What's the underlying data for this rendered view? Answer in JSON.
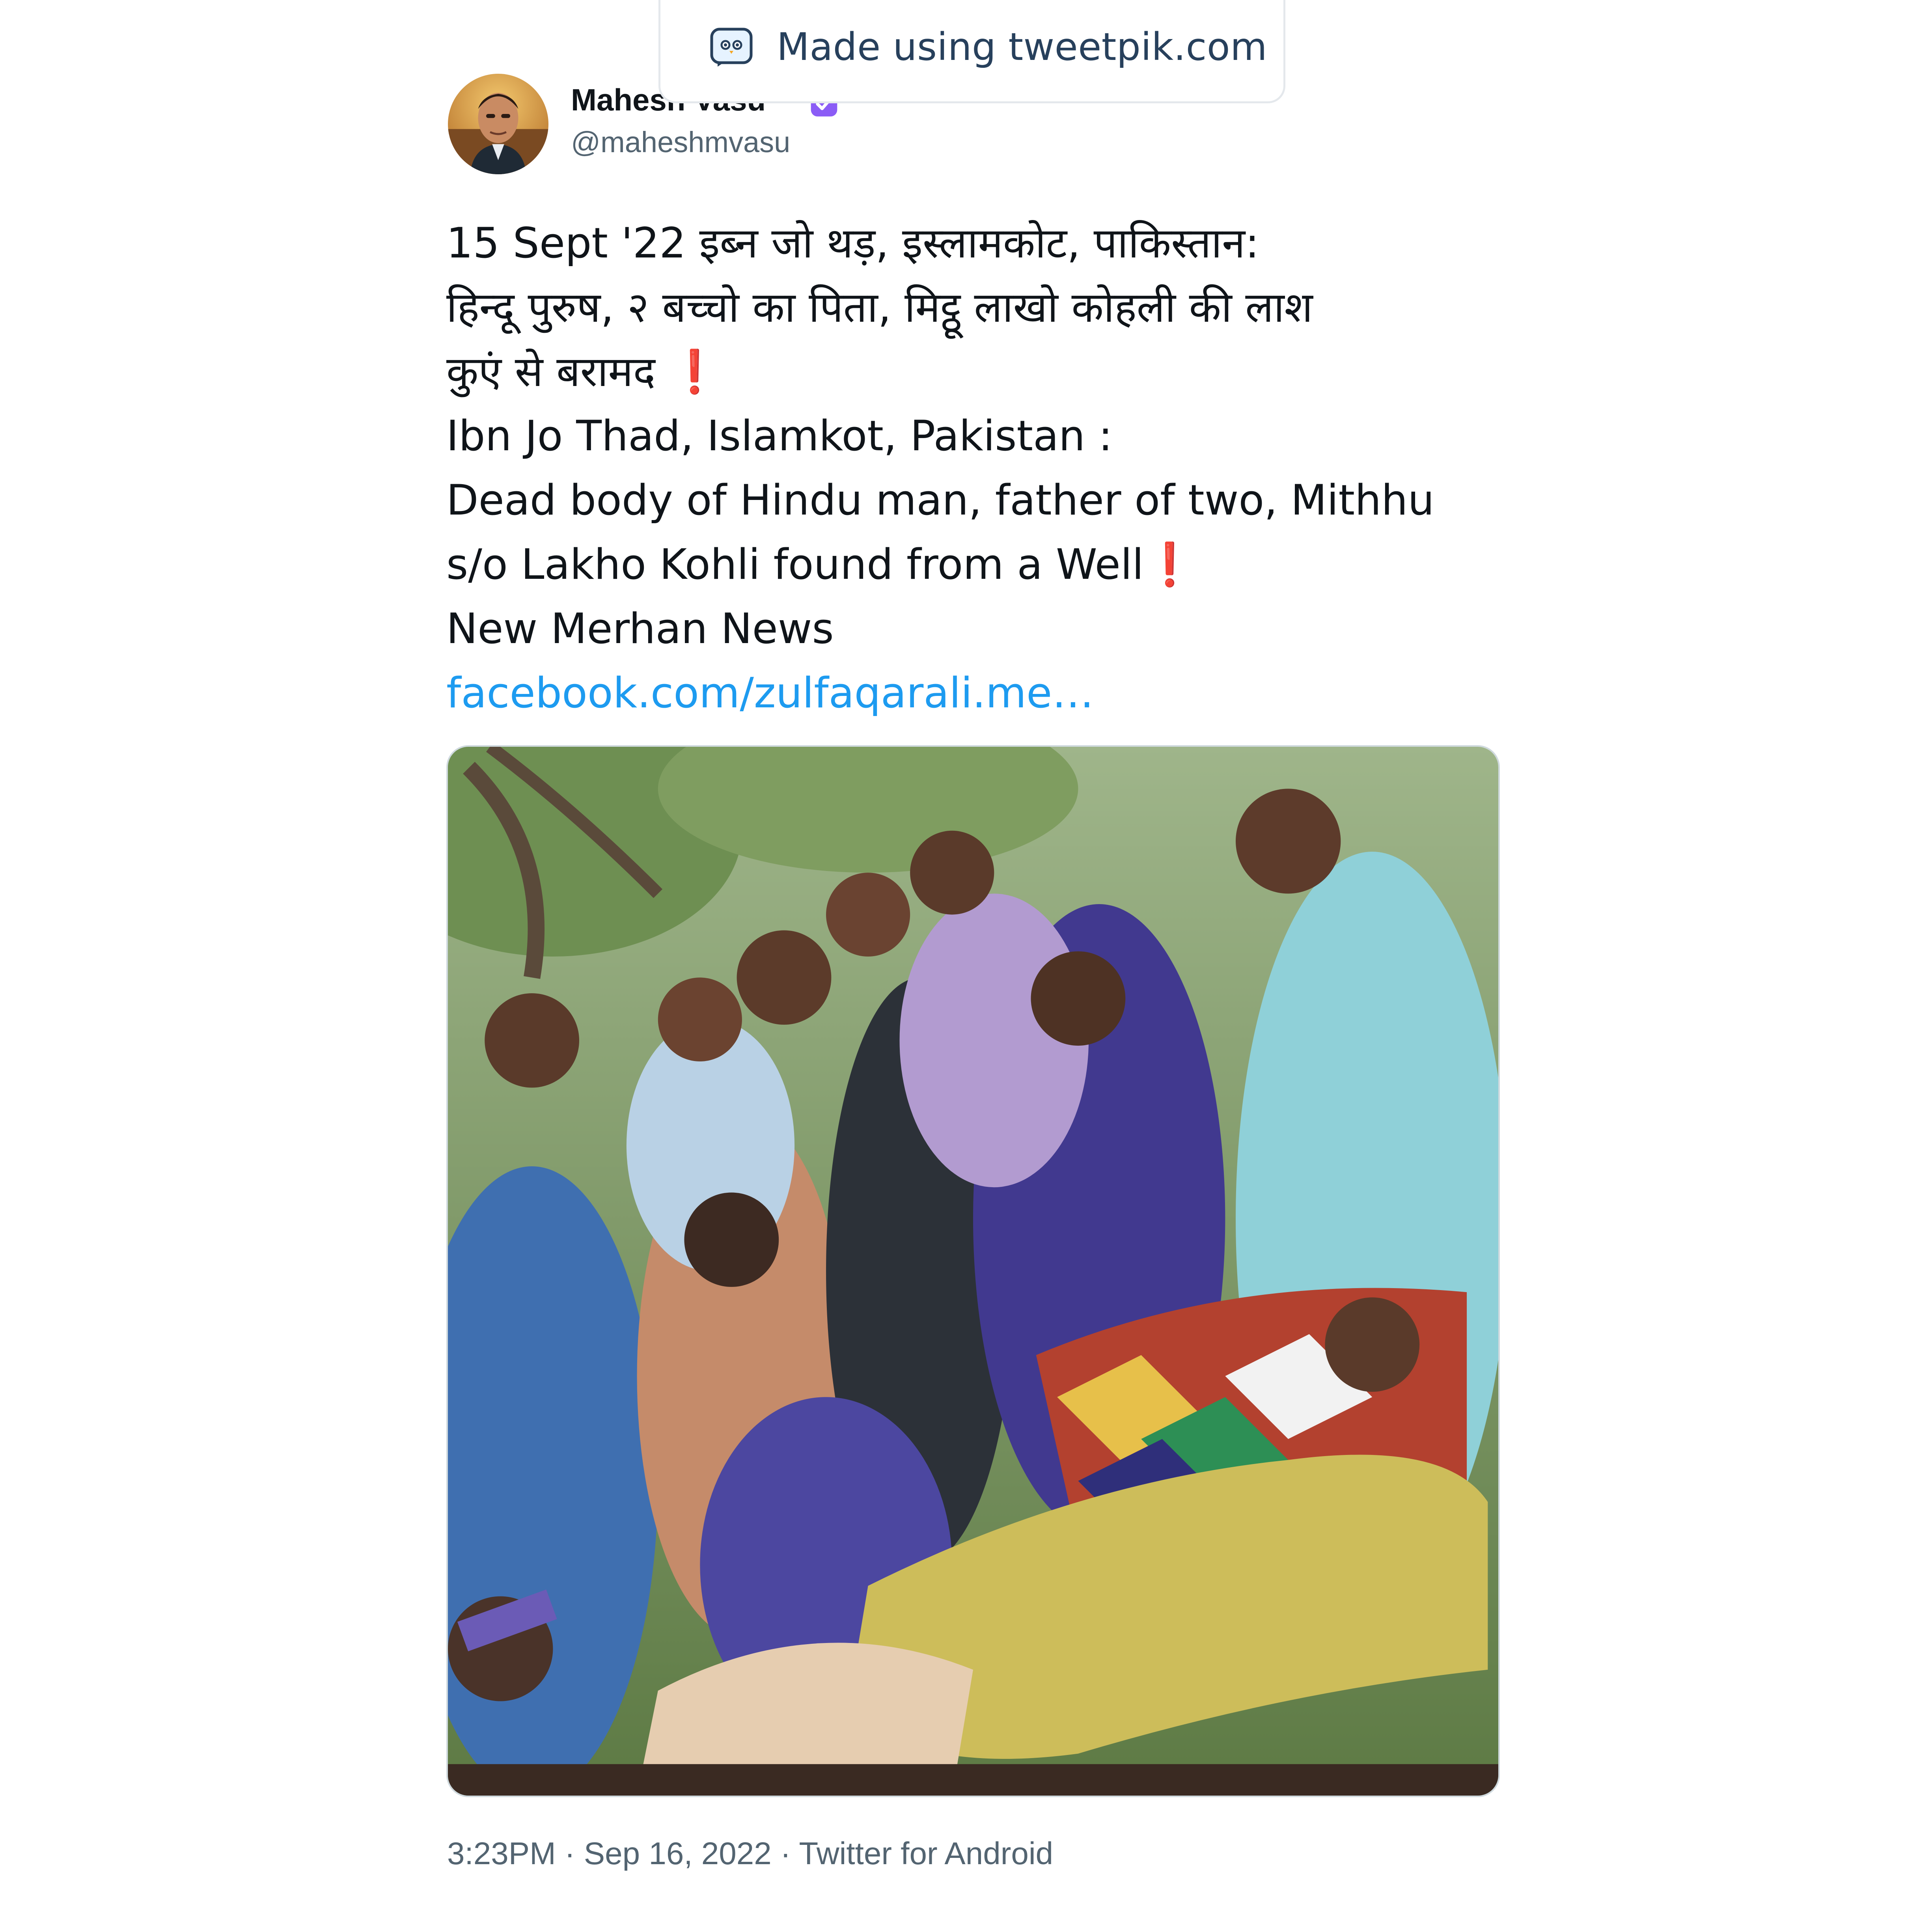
{
  "watermark": {
    "text": "Made using tweetpik.com",
    "icon": "tweetpik-logo-icon"
  },
  "author": {
    "display_name": "Mahesh Vasu",
    "handle": "@maheshmvasu",
    "avatar_icon": "avatar",
    "verified_icon": "verified-badge-icon",
    "verified_color": "#8b5cf6"
  },
  "tweet": {
    "lines": [
      "15 Sept '22 इब्न जो थड़, इस्लामकोट, पाकिस्तान:",
      "हिन्दू पुरुष, २ बच्चो का पिता, मिट्ठू लाखो कोहली की लाश",
      "कुएं से बरामद",
      "Ibn Jo Thad, Islamkot, Pakistan :",
      "Dead body of Hindu man, father of two, Mithhu",
      "s/o Lakho Kohli found from a Well",
      "New Merhan News"
    ],
    "exclaim": "❗",
    "link": "facebook.com/zulfaqarali.me…",
    "link_color": "#1d9bf0"
  },
  "media": {
    "icon": "photo"
  },
  "footer": {
    "meta": "3:23PM · Sep 16, 2022 · Twitter for Android"
  }
}
